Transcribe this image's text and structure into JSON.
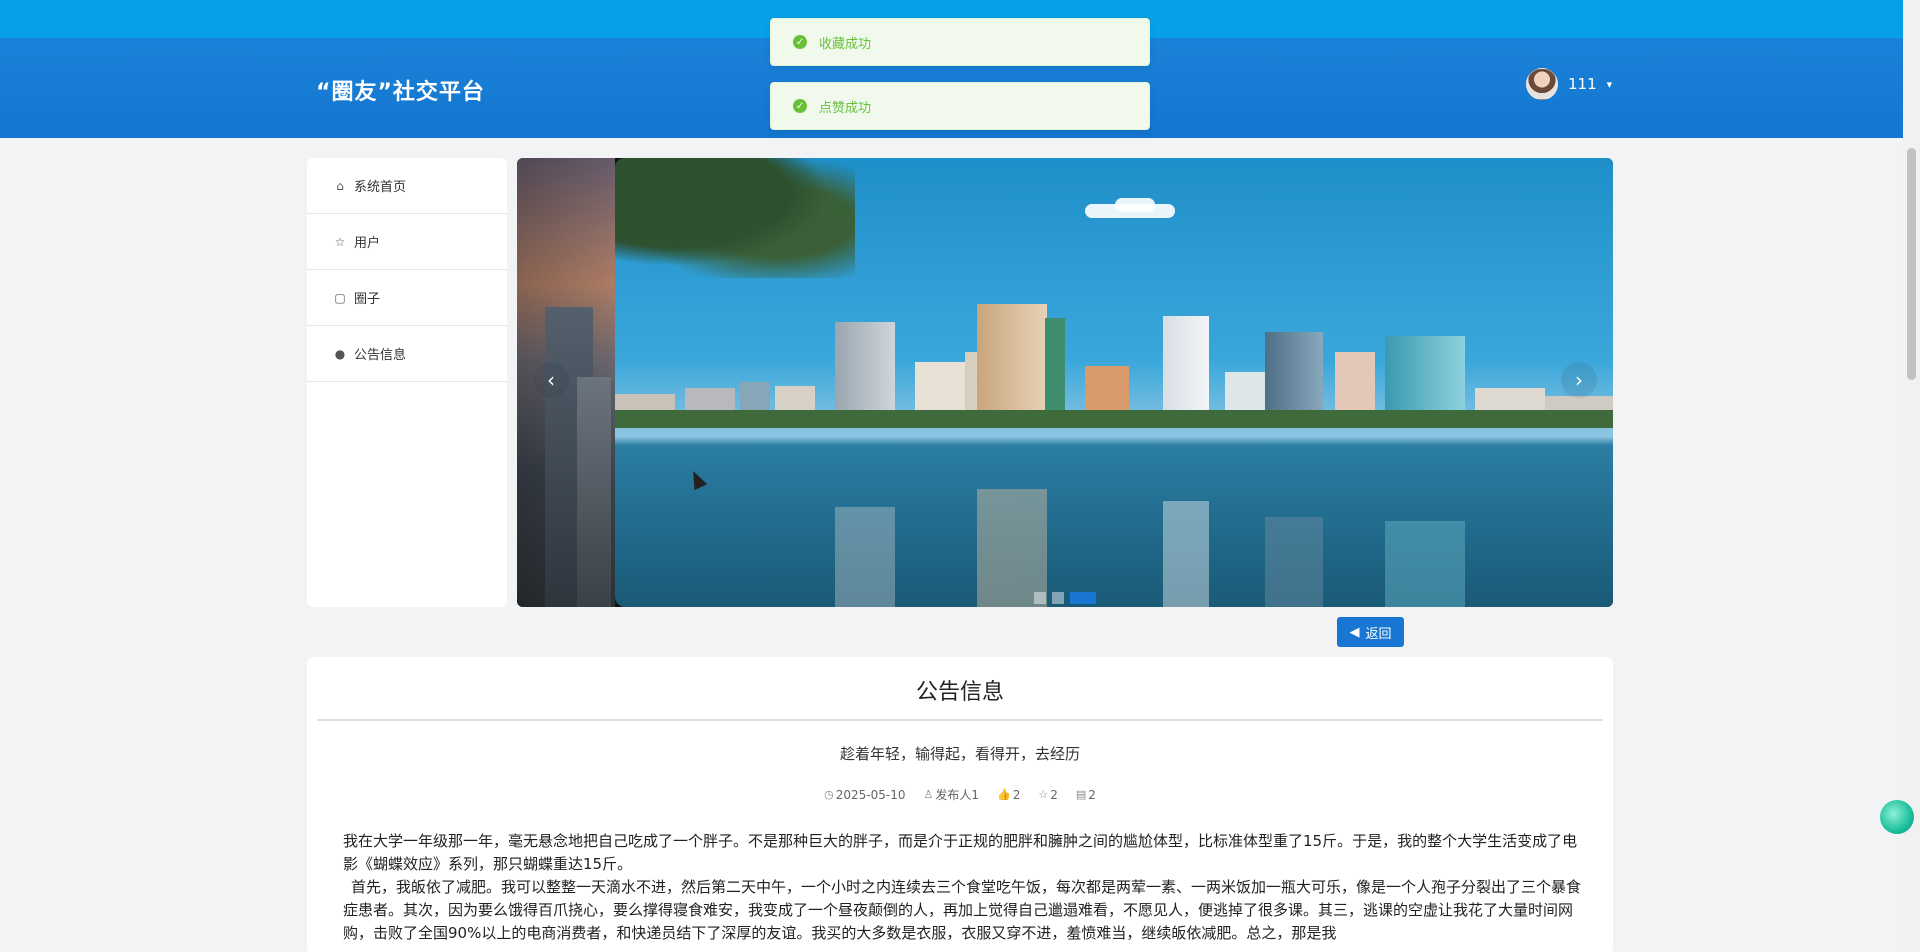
{
  "header": {
    "brand": "“圈友”社交平台",
    "user_name": "111",
    "caret": "▾"
  },
  "toasts": [
    {
      "text": "收藏成功",
      "icon": "success-icon"
    },
    {
      "text": "点赞成功",
      "icon": "success-icon"
    }
  ],
  "sidebar": {
    "items": [
      {
        "label": "系统首页",
        "icon": "home-icon"
      },
      {
        "label": "用户",
        "icon": "star-icon"
      },
      {
        "label": "圈子",
        "icon": "bag-icon"
      },
      {
        "label": "公告信息",
        "icon": "alert-icon"
      }
    ]
  },
  "carousel": {
    "prev": "‹",
    "next": "›",
    "slide_count": 3,
    "active_slide": 3
  },
  "back_button": {
    "label": "返回",
    "icon": "caret-left-icon"
  },
  "article": {
    "section_title": "公告信息",
    "title": "趁着年轻，输得起，看得开，去经历",
    "date": "2025-05-10",
    "author": "发布人1",
    "likes": "2",
    "favorites": "2",
    "comments": "2",
    "paragraph1": "我在大学一年级那一年，毫无悬念地把自己吃成了一个胖子。不是那种巨大的胖子，而是介于正规的肥胖和臃肿之间的尴尬体型，比标准体型重了15斤。于是，我的整个大学生活变成了电影《蝴蝶效应》系列，那只蝴蝶重达15斤。",
    "paragraph2": "首先，我皈依了减肥。我可以整整一天滴水不进，然后第二天中午，一个小时之内连续去三个食堂吃午饭，每次都是两荤一素、一两米饭加一瓶大可乐，像是一个人孢子分裂出了三个暴食症患者。其次，因为要么饿得百爪挠心，要么撑得寝食难安，我变成了一个昼夜颠倒的人，再加上觉得自己邋遢难看，不愿见人，便逃掉了很多课。其三，逃课的空虚让我花了大量时间网购，击败了全国90%以上的电商消费者，和快递员结下了深厚的友谊。我买的大多数是衣服，衣服又穿不进，羞愤难当，继续皈依减肥。总之，那是我"
  }
}
